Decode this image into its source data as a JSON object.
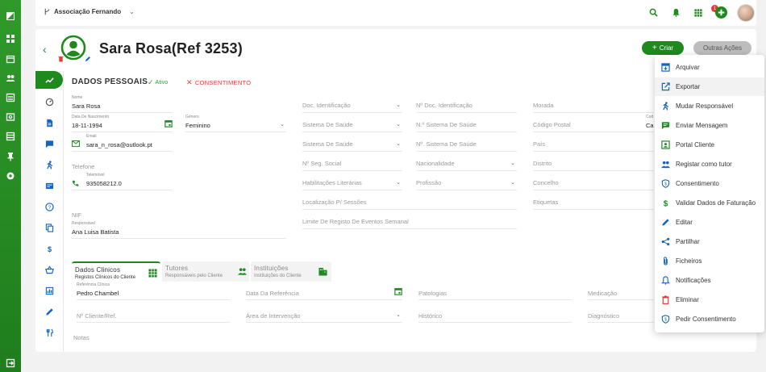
{
  "topbar": {
    "org_name": "Associação Fernando",
    "notification_count": "1"
  },
  "header": {
    "title": "Sara Rosa(Ref 3253)",
    "criar_label": "Criar",
    "outras_label": "Outras Ações"
  },
  "section": {
    "title": "DADOS PESSOAIS",
    "status": "Ativo",
    "consent": "CONSENTIMENTO"
  },
  "fields": {
    "nome_label": "Nome",
    "nome": "Sara Rosa",
    "nasc_label": "Data De Nascimento",
    "nasc": "18-11-1994",
    "genero_label": "Género",
    "genero": "Feminino",
    "email_label": "Email",
    "email": "sara_n_rosa@outlook.pt",
    "telefone": "Telefone",
    "telemovel_label": "Telemóvel",
    "telemovel": "935058212.0",
    "nif": "NIF",
    "responsavel_label": "Responsável",
    "responsavel": "Ana Luisa Batista",
    "doc_ident": "Doc. Identificação",
    "n_doc_ident": "Nº Doc. Identificação",
    "sist_saude_1": "Sistema De Saúde",
    "n_sist_saude_1": "N.º Sistema De Saúde",
    "sist_saude_2": "Sistema De Saúde",
    "n_sist_saude_2": "Nº. Sistema De Saúde",
    "seg_social": "Nº Seg. Social",
    "nacionalidade": "Nacionalidade",
    "habilitacoes": "Habilitações Literárias",
    "profissao": "Profissão",
    "localizacao": "Localização P/ Sessões",
    "limite": "Limite De Registo De Eventos Semanal",
    "morada": "Morada",
    "codigo_postal": "Código Postal",
    "cod_label": "Cod",
    "cod_value": "Ca",
    "pais": "País",
    "distrito": "Distrito",
    "concelho": "Concelho",
    "etiquetas": "Etiquetas"
  },
  "subtabs": [
    {
      "title": "Dados Clinicos",
      "subtitle": "Registos Clínicos do Cliente"
    },
    {
      "title": "Tutores",
      "subtitle": "Responsáveis pelo Cliente"
    },
    {
      "title": "Instituições",
      "subtitle": "Instituições do Cliente"
    }
  ],
  "clinical": {
    "ref_clinica_label": "Referência Clínica",
    "ref_clinica": "Pedro Chambel",
    "data_ref": "Data Da Referência",
    "patologias": "Patologias",
    "medicacao": "Medicação",
    "n_cliente": "Nº Cliente/Ref.",
    "area": "Área de Intervenção",
    "historico": "Histórico",
    "diagnostico": "Diagnóstico",
    "notas": "Notas"
  },
  "menu": [
    {
      "label": "Arquivar",
      "icon": "archive-icon"
    },
    {
      "label": "Exportar",
      "icon": "export-icon"
    },
    {
      "label": "Mudar Responsável",
      "icon": "transfer-person-icon"
    },
    {
      "label": "Enviar Mensagem",
      "icon": "message-icon"
    },
    {
      "label": "Portal Cliente",
      "icon": "portal-icon"
    },
    {
      "label": "Registar como tutor",
      "icon": "people-icon"
    },
    {
      "label": "Consentimento",
      "icon": "shield-icon"
    },
    {
      "label": "Validar Dados de Faturação",
      "icon": "dollar-icon"
    },
    {
      "label": "Editar",
      "icon": "pencil-icon"
    },
    {
      "label": "Partilhar",
      "icon": "share-icon"
    },
    {
      "label": "Ficheiros",
      "icon": "attachment-icon"
    },
    {
      "label": "Notificações",
      "icon": "bell-icon"
    },
    {
      "label": "Eliminar",
      "icon": "trash-icon"
    },
    {
      "label": "Pedir Consentimento",
      "icon": "shield-icon"
    }
  ],
  "colors": {
    "brand": "#1e8a1e",
    "danger": "#e53935",
    "menu_blue": "#1565c0"
  }
}
